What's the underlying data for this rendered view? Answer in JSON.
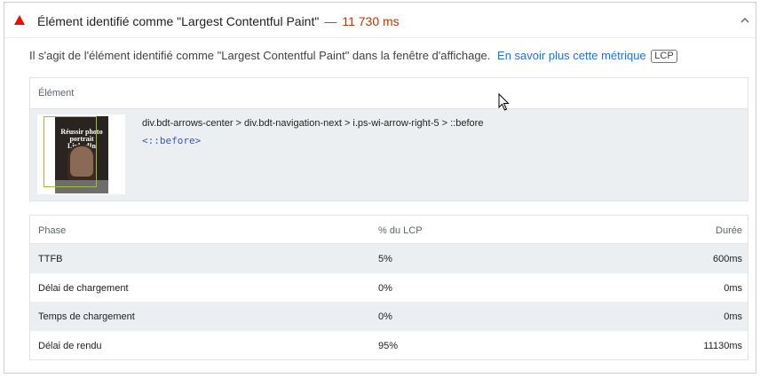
{
  "audit": {
    "title": "Élément identifié comme \"Largest Contentful Paint\"",
    "separator": "—",
    "value": "11 730 ms",
    "description": "Il s'agit de l'élément identifié comme \"Largest Contentful Paint\" dans la fenêtre d'affichage.",
    "link_text": "En savoir plus cette métrique",
    "badge": "LCP",
    "icons": {
      "status": "fail-triangle-icon",
      "toggle": "chevron-up-icon"
    },
    "colors": {
      "fail": "#eb0f00",
      "link": "#1a73e8",
      "row_alt": "#eceff1"
    }
  },
  "element_table": {
    "header": "Élément",
    "thumbnail": {
      "line1": "Réussir photo",
      "line2": "portrait LinkedIn"
    },
    "node_path": "div.bdt-arrows-center > div.bdt-navigation-next > i.ps-wi-arrow-right-5 > ::before",
    "node_snippet": "<::before>"
  },
  "phase_table": {
    "headers": [
      "Phase",
      "% du LCP",
      "Durée"
    ],
    "rows": [
      {
        "phase": "TTFB",
        "percent": "5%",
        "duration": "600ms"
      },
      {
        "phase": "Délai de chargement",
        "percent": "0%",
        "duration": "0ms"
      },
      {
        "phase": "Temps de chargement",
        "percent": "0%",
        "duration": "0ms"
      },
      {
        "phase": "Délai de rendu",
        "percent": "95%",
        "duration": "11130ms"
      }
    ]
  }
}
